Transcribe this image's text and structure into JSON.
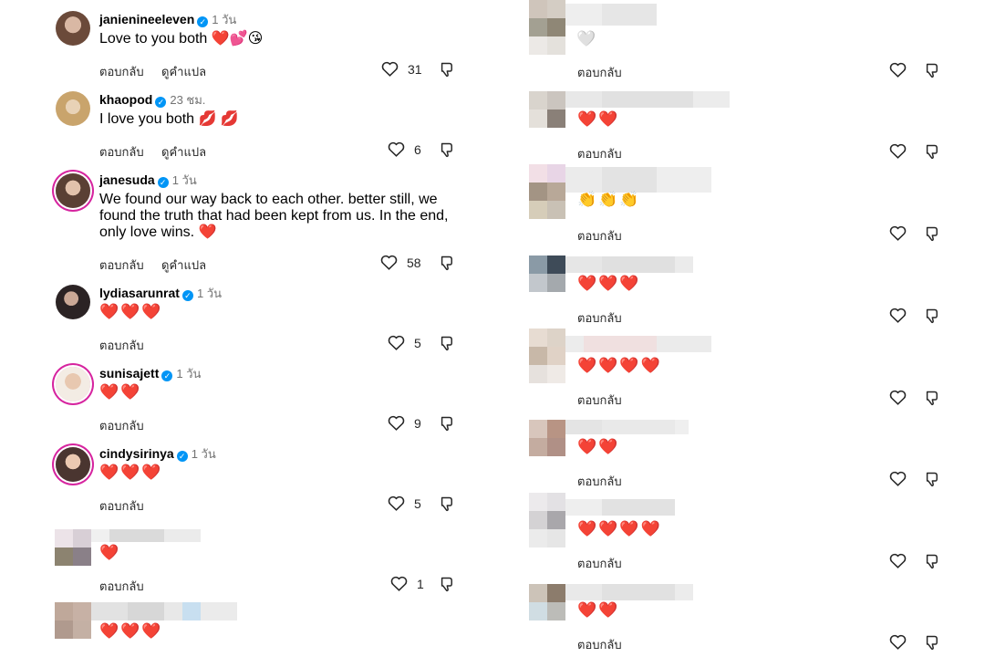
{
  "actions": {
    "reply": "ตอบกลับ",
    "translate": "ดูคำแปล"
  },
  "left_comments": [
    {
      "username": "janienineeleven",
      "time": "1 วัน",
      "text": "Love to you both ❤️💕😘",
      "likes": "31"
    },
    {
      "username": "khaopod",
      "time": "23 ชม.",
      "text": "I love you both 💋 💋",
      "likes": "6"
    },
    {
      "username": "janesuda",
      "time": "1 วัน",
      "text": "We found our way back to each other. better still, we found the truth that had been kept from us. In the end, only love wins. ❤️",
      "likes": "58"
    },
    {
      "username": "lydiasarunrat",
      "time": "1 วัน",
      "text": "❤️❤️❤️",
      "likes": "5"
    },
    {
      "username": "sunisajett",
      "time": "1 วัน",
      "text": "❤️❤️",
      "likes": "9"
    },
    {
      "username": "cindysirinya",
      "time": "1 วัน",
      "text": "❤️❤️❤️",
      "likes": "5"
    },
    {
      "username": "",
      "time": "",
      "text": "❤️",
      "likes": "1"
    },
    {
      "username": "",
      "time": "",
      "text": "❤️❤️❤️",
      "likes": ""
    }
  ],
  "right_comments": [
    {
      "text": "🤍"
    },
    {
      "text": "❤️❤️"
    },
    {
      "text": "👏👏👏"
    },
    {
      "text": "❤️❤️❤️"
    },
    {
      "text": "❤️❤️❤️❤️"
    },
    {
      "text": "❤️❤️"
    },
    {
      "text": "❤️❤️❤️❤️"
    },
    {
      "text": "❤️❤️"
    }
  ],
  "colors": {
    "verified": "#0095f6",
    "heart": "#e0243a",
    "ring": "#d6249f",
    "secondary_text": "#737373"
  },
  "icons": {
    "like": "heart-outline-icon",
    "dislike": "thumbs-down-icon",
    "verified": "verified-badge-icon"
  }
}
